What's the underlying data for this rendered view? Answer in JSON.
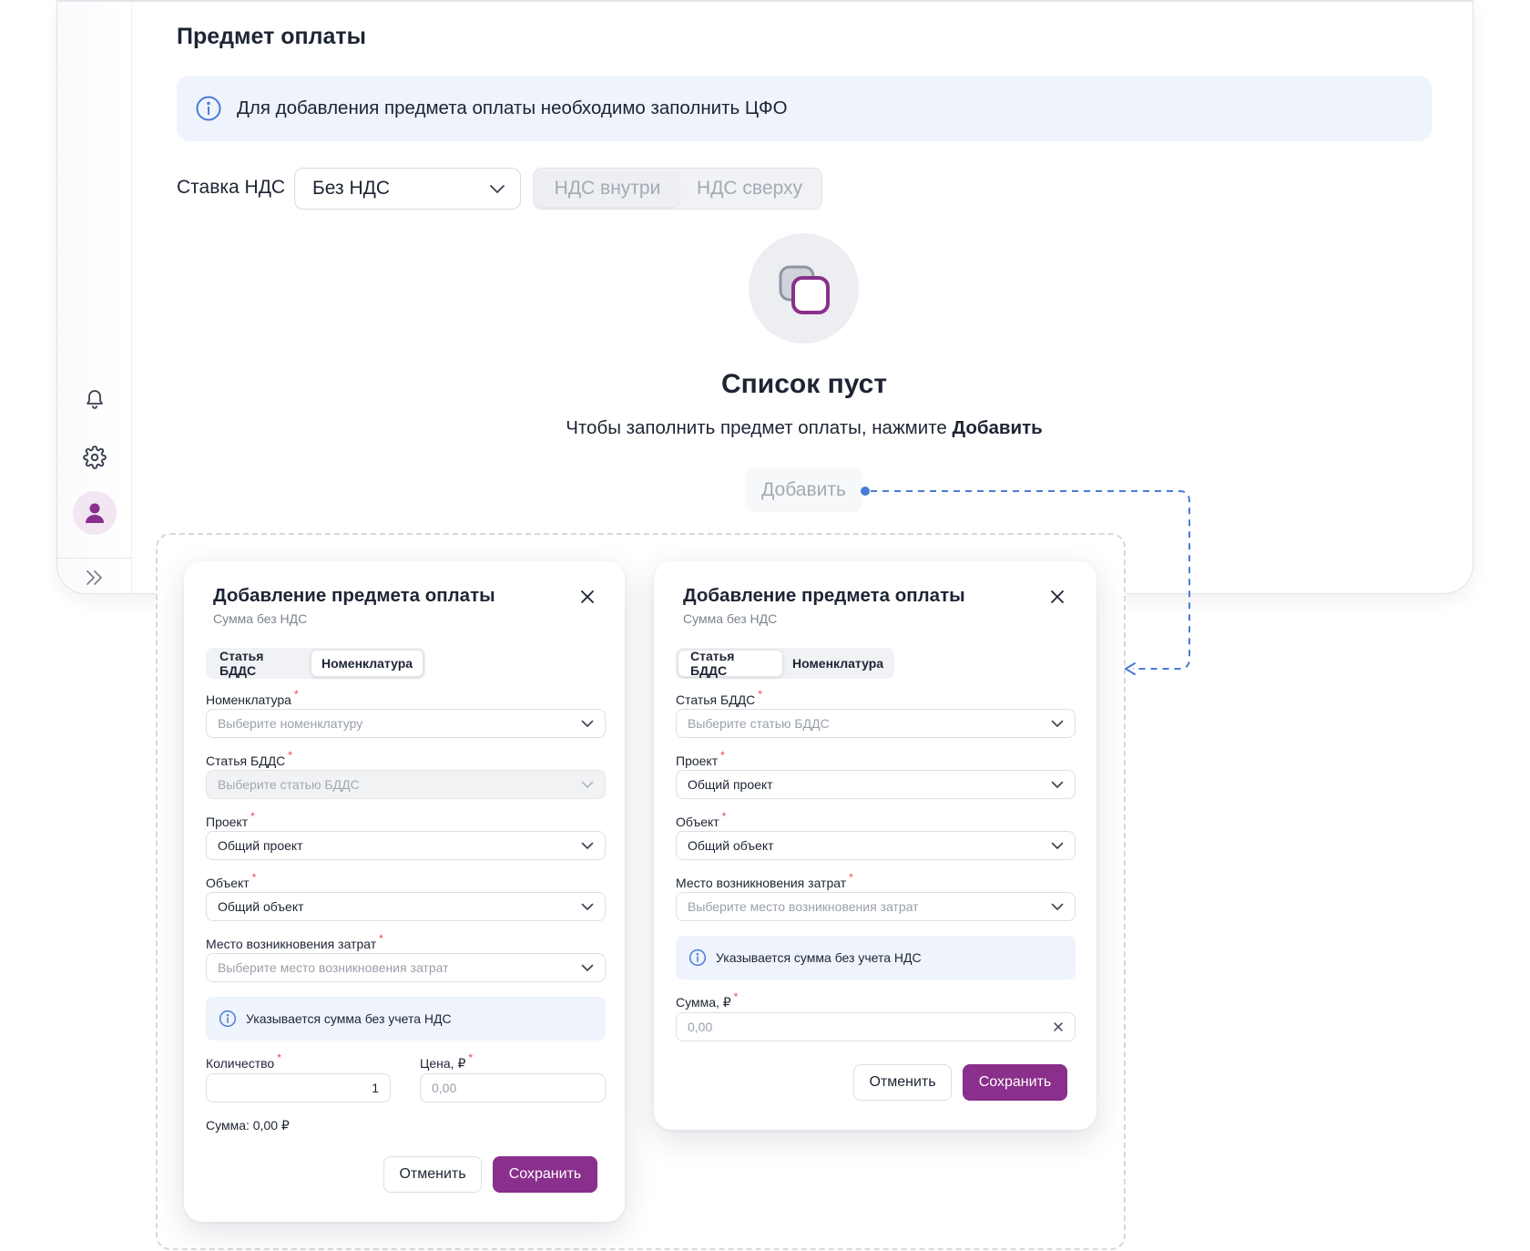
{
  "page": {
    "title": "Предмет оплаты",
    "info_banner": "Для добавления предмета оплаты необходимо заполнить ЦФО",
    "vat": {
      "label": "Ставка НДС",
      "selected": "Без НДС",
      "modes": [
        "НДС внутри",
        "НДС сверху"
      ]
    },
    "empty_state": {
      "title": "Список пуст",
      "subtitle_prefix": "Чтобы заполнить предмет оплаты, нажмите ",
      "subtitle_bold": "Добавить",
      "add_button": "Добавить"
    }
  },
  "sidebar": {
    "icons": [
      "bell-icon",
      "gear-icon",
      "user-icon",
      "double-chevron-right-icon"
    ]
  },
  "dialog_nomenclature": {
    "title": "Добавление предмета оплаты",
    "subtitle": "Сумма без НДС",
    "tabs": [
      "Статья БДДС",
      "Номенклатура"
    ],
    "active_tab": "Номенклатура",
    "fields": {
      "nomenclature": {
        "label": "Номенклатура",
        "placeholder": "Выберите номенклатуру"
      },
      "bdds": {
        "label": "Статья БДДС",
        "placeholder": "Выберите статью БДДС"
      },
      "project": {
        "label": "Проект",
        "value": "Общий проект"
      },
      "object": {
        "label": "Объект",
        "value": "Общий объект"
      },
      "cost_center": {
        "label": "Место возникновения затрат",
        "placeholder": "Выберите место возникновения затрат"
      }
    },
    "note": "Указывается сумма без учета НДС",
    "quantity": {
      "label": "Количество",
      "value": "1"
    },
    "price": {
      "label": "Цена, ₽",
      "placeholder": "0,00"
    },
    "sum_text": "Сумма: 0,00 ₽",
    "cancel": "Отменить",
    "save": "Сохранить"
  },
  "dialog_bdds": {
    "title": "Добавление предмета оплаты",
    "subtitle": "Сумма без НДС",
    "tabs": [
      "Статья БДДС",
      "Номенклатура"
    ],
    "active_tab": "Статья БДДС",
    "fields": {
      "bdds": {
        "label": "Статья БДДС",
        "placeholder": "Выберите статью БДДС"
      },
      "project": {
        "label": "Проект",
        "value": "Общий проект"
      },
      "object": {
        "label": "Объект",
        "value": "Общий объект"
      },
      "cost_center": {
        "label": "Место возникновения затрат",
        "placeholder": "Выберите место возникновения затрат"
      }
    },
    "note": "Указывается сумма без учета НДС",
    "amount": {
      "label": "Сумма, ₽",
      "placeholder": "0,00"
    },
    "cancel": "Отменить",
    "save": "Сохранить"
  },
  "colors": {
    "accent": "#8a2f8b",
    "info_bg": "#eef3fc",
    "info_icon": "#4a7bd6",
    "flow_line": "#4a7bd6",
    "required": "#e5484d"
  }
}
